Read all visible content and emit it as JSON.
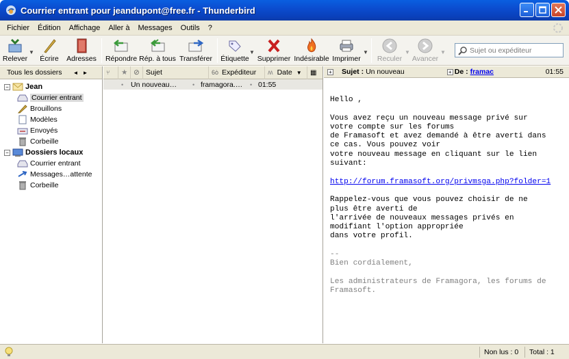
{
  "window": {
    "title": "Courrier entrant pour jeandupont@free.fr - Thunderbird"
  },
  "menu": [
    "Fichier",
    "Édition",
    "Affichage",
    "Aller à",
    "Messages",
    "Outils",
    "?"
  ],
  "toolbar": {
    "get_mail": "Relever",
    "write": "Écrire",
    "address_book": "Adresses",
    "reply": "Répondre",
    "reply_all": "Rép. à tous",
    "forward": "Transférer",
    "tag": "Étiquette",
    "delete": "Supprimer",
    "junk": "Indésirable",
    "print": "Imprimer",
    "back": "Reculer",
    "forward_nav": "Avancer",
    "search_placeholder": "Sujet ou expéditeur"
  },
  "folders": {
    "header": "Tous les dossiers",
    "account_name": "Jean",
    "account_folders": [
      "Courrier entrant",
      "Brouillons",
      "Modèles",
      "Envoyés",
      "Corbeille"
    ],
    "local_name": "Dossiers locaux",
    "local_folders": [
      "Courrier entrant",
      "Messages…attente",
      "Corbeille"
    ]
  },
  "thread_columns": {
    "subject": "Sujet",
    "sender": "Expéditeur",
    "date": "Date"
  },
  "messages": [
    {
      "subject": "Un nouveau…",
      "sender": "framagora.…",
      "date": "01:55"
    }
  ],
  "message_header": {
    "subject_label": "Sujet :",
    "subject_value": "Un nouveau",
    "from_label": "De :",
    "from_value": "framac",
    "time": "01:55"
  },
  "message_body": {
    "greeting": "Hello ,",
    "p1": "Vous avez reçu un nouveau message privé sur\nvotre compte sur les forums\nde Framasoft et avez demandé à être averti dans\nce cas. Vous pouvez voir\nvotre nouveau message en cliquant sur le lien\nsuivant:",
    "link": "http://forum.framasoft.org/privmsga.php?folder=1",
    "p2": "Rappelez-vous que vous pouvez choisir de ne\nplus être averti de\nl'arrivée de nouveaux messages privés en\nmodifiant l'option appropriée\ndans votre profil.",
    "sig_sep": "--",
    "sig1": "Bien cordialement,",
    "sig2": "Les administrateurs de Framagora, les forums de\nFramasoft."
  },
  "status": {
    "unread": "Non lus : 0",
    "total": "Total : 1"
  }
}
